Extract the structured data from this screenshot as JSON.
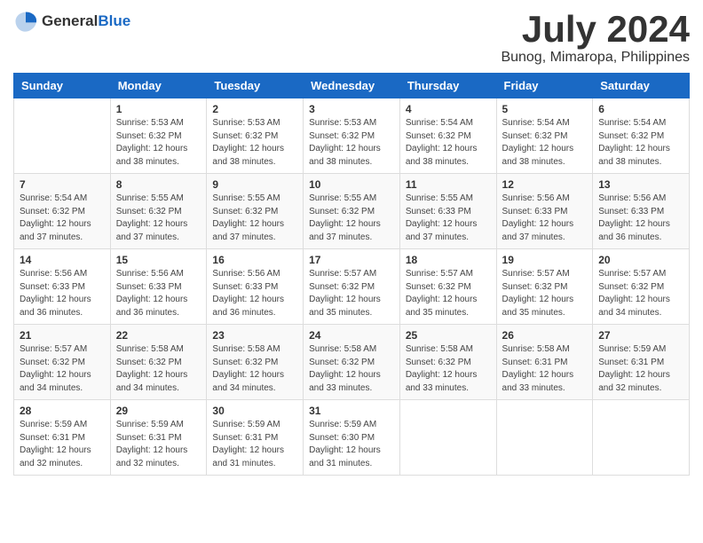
{
  "logo": {
    "text_general": "General",
    "text_blue": "Blue"
  },
  "title": {
    "month_year": "July 2024",
    "location": "Bunog, Mimaropa, Philippines"
  },
  "days_of_week": [
    "Sunday",
    "Monday",
    "Tuesday",
    "Wednesday",
    "Thursday",
    "Friday",
    "Saturday"
  ],
  "weeks": [
    [
      {
        "day": "",
        "detail": ""
      },
      {
        "day": "1",
        "detail": "Sunrise: 5:53 AM\nSunset: 6:32 PM\nDaylight: 12 hours\nand 38 minutes."
      },
      {
        "day": "2",
        "detail": "Sunrise: 5:53 AM\nSunset: 6:32 PM\nDaylight: 12 hours\nand 38 minutes."
      },
      {
        "day": "3",
        "detail": "Sunrise: 5:53 AM\nSunset: 6:32 PM\nDaylight: 12 hours\nand 38 minutes."
      },
      {
        "day": "4",
        "detail": "Sunrise: 5:54 AM\nSunset: 6:32 PM\nDaylight: 12 hours\nand 38 minutes."
      },
      {
        "day": "5",
        "detail": "Sunrise: 5:54 AM\nSunset: 6:32 PM\nDaylight: 12 hours\nand 38 minutes."
      },
      {
        "day": "6",
        "detail": "Sunrise: 5:54 AM\nSunset: 6:32 PM\nDaylight: 12 hours\nand 38 minutes."
      }
    ],
    [
      {
        "day": "7",
        "detail": "Sunrise: 5:54 AM\nSunset: 6:32 PM\nDaylight: 12 hours\nand 37 minutes."
      },
      {
        "day": "8",
        "detail": "Sunrise: 5:55 AM\nSunset: 6:32 PM\nDaylight: 12 hours\nand 37 minutes."
      },
      {
        "day": "9",
        "detail": "Sunrise: 5:55 AM\nSunset: 6:32 PM\nDaylight: 12 hours\nand 37 minutes."
      },
      {
        "day": "10",
        "detail": "Sunrise: 5:55 AM\nSunset: 6:32 PM\nDaylight: 12 hours\nand 37 minutes."
      },
      {
        "day": "11",
        "detail": "Sunrise: 5:55 AM\nSunset: 6:33 PM\nDaylight: 12 hours\nand 37 minutes."
      },
      {
        "day": "12",
        "detail": "Sunrise: 5:56 AM\nSunset: 6:33 PM\nDaylight: 12 hours\nand 37 minutes."
      },
      {
        "day": "13",
        "detail": "Sunrise: 5:56 AM\nSunset: 6:33 PM\nDaylight: 12 hours\nand 36 minutes."
      }
    ],
    [
      {
        "day": "14",
        "detail": "Sunrise: 5:56 AM\nSunset: 6:33 PM\nDaylight: 12 hours\nand 36 minutes."
      },
      {
        "day": "15",
        "detail": "Sunrise: 5:56 AM\nSunset: 6:33 PM\nDaylight: 12 hours\nand 36 minutes."
      },
      {
        "day": "16",
        "detail": "Sunrise: 5:56 AM\nSunset: 6:33 PM\nDaylight: 12 hours\nand 36 minutes."
      },
      {
        "day": "17",
        "detail": "Sunrise: 5:57 AM\nSunset: 6:32 PM\nDaylight: 12 hours\nand 35 minutes."
      },
      {
        "day": "18",
        "detail": "Sunrise: 5:57 AM\nSunset: 6:32 PM\nDaylight: 12 hours\nand 35 minutes."
      },
      {
        "day": "19",
        "detail": "Sunrise: 5:57 AM\nSunset: 6:32 PM\nDaylight: 12 hours\nand 35 minutes."
      },
      {
        "day": "20",
        "detail": "Sunrise: 5:57 AM\nSunset: 6:32 PM\nDaylight: 12 hours\nand 34 minutes."
      }
    ],
    [
      {
        "day": "21",
        "detail": "Sunrise: 5:57 AM\nSunset: 6:32 PM\nDaylight: 12 hours\nand 34 minutes."
      },
      {
        "day": "22",
        "detail": "Sunrise: 5:58 AM\nSunset: 6:32 PM\nDaylight: 12 hours\nand 34 minutes."
      },
      {
        "day": "23",
        "detail": "Sunrise: 5:58 AM\nSunset: 6:32 PM\nDaylight: 12 hours\nand 34 minutes."
      },
      {
        "day": "24",
        "detail": "Sunrise: 5:58 AM\nSunset: 6:32 PM\nDaylight: 12 hours\nand 33 minutes."
      },
      {
        "day": "25",
        "detail": "Sunrise: 5:58 AM\nSunset: 6:32 PM\nDaylight: 12 hours\nand 33 minutes."
      },
      {
        "day": "26",
        "detail": "Sunrise: 5:58 AM\nSunset: 6:31 PM\nDaylight: 12 hours\nand 33 minutes."
      },
      {
        "day": "27",
        "detail": "Sunrise: 5:59 AM\nSunset: 6:31 PM\nDaylight: 12 hours\nand 32 minutes."
      }
    ],
    [
      {
        "day": "28",
        "detail": "Sunrise: 5:59 AM\nSunset: 6:31 PM\nDaylight: 12 hours\nand 32 minutes."
      },
      {
        "day": "29",
        "detail": "Sunrise: 5:59 AM\nSunset: 6:31 PM\nDaylight: 12 hours\nand 32 minutes."
      },
      {
        "day": "30",
        "detail": "Sunrise: 5:59 AM\nSunset: 6:31 PM\nDaylight: 12 hours\nand 31 minutes."
      },
      {
        "day": "31",
        "detail": "Sunrise: 5:59 AM\nSunset: 6:30 PM\nDaylight: 12 hours\nand 31 minutes."
      },
      {
        "day": "",
        "detail": ""
      },
      {
        "day": "",
        "detail": ""
      },
      {
        "day": "",
        "detail": ""
      }
    ]
  ]
}
